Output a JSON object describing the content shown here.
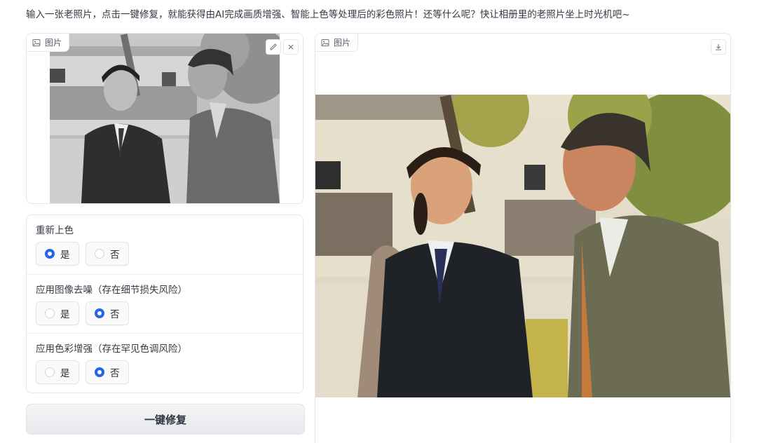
{
  "intro": "输入一张老照片，点击一键修复，就能获得由AI完成画质增强、智能上色等处理后的彩色照片！还等什么呢？快让相册里的老照片坐上时光机吧~",
  "input_panel": {
    "tag_label": "图片",
    "tag_icon": "image-icon",
    "edit_icon": "pencil-icon",
    "clear_icon": "close-icon"
  },
  "options": [
    {
      "label": "重新上色",
      "choices": [
        "是",
        "否"
      ],
      "selected": "是"
    },
    {
      "label": "应用图像去噪（存在细节损失风险）",
      "choices": [
        "是",
        "否"
      ],
      "selected": "否"
    },
    {
      "label": "应用色彩增强（存在罕见色调风险）",
      "choices": [
        "是",
        "否"
      ],
      "selected": "否"
    }
  ],
  "run_button": "一键修复",
  "output_panel": {
    "tag_label": "图片",
    "tag_icon": "image-icon",
    "download_icon": "download-icon"
  },
  "colors": {
    "accent": "#2563eb",
    "border": "#e5e7eb",
    "text": "#2b2f36"
  }
}
